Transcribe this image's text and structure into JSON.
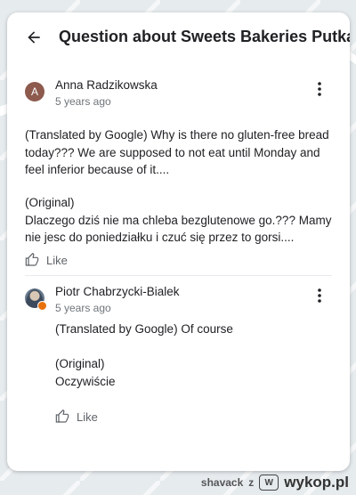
{
  "header": {
    "title": "Question about Sweets Bakeries Putka"
  },
  "reviews": [
    {
      "author": "Anna Radzikowska",
      "avatar_initial": "A",
      "time": "5 years ago",
      "translated_lines": [
        "(Translated by Google) Why is there no gluten-free bread",
        "today??? We are supposed to not eat until Monday and",
        "feel inferior because of it...."
      ],
      "original_label": "(Original)",
      "original_lines": [
        "Dlaczego dziś nie ma chleba bezglutenowe go.??? Mamy",
        "nie jesc do poniedziałku i czuć się przez to gorsi...."
      ],
      "like_label": "Like"
    },
    {
      "author": "Piotr Chabrzycki-Bialek",
      "time": "5 years ago",
      "translated_lines": [
        "(Translated by Google) Of course"
      ],
      "original_label": "(Original)",
      "original_lines": [
        "Oczywiście"
      ],
      "like_label": "Like"
    }
  ],
  "watermark": {
    "user": "shavack",
    "letter": "z",
    "site": "wykop.pl"
  }
}
